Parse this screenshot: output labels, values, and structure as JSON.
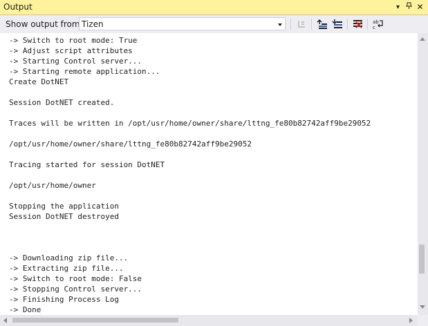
{
  "window": {
    "title": "Output"
  },
  "toolbar": {
    "show_output_label": "Show output from:",
    "source_value": "Tizen"
  },
  "log_lines": [
    "-> Switch to root mode: True",
    "-> Adjust script attributes",
    "-> Starting Control server...",
    "-> Starting remote application...",
    "Create DotNET",
    "",
    "Session DotNET created.",
    "",
    "Traces will be written in /opt/usr/home/owner/share/lttng_fe80b82742aff9be29052",
    "",
    "/opt/usr/home/owner/share/lttng_fe80b82742aff9be29052",
    "",
    "Tracing started for session DotNET",
    "",
    "/opt/usr/home/owner",
    "",
    "Stopping the application",
    "Session DotNET destroyed",
    "",
    "",
    "",
    "-> Downloading zip file...",
    "-> Extracting zip file...",
    "-> Switch to root mode: False",
    "-> Stopping Control server...",
    "-> Finishing Process Log",
    "-> Done"
  ],
  "colors": {
    "title_bar": "#fff29d",
    "background": "#eeeef2",
    "editor": "#ffffff"
  }
}
